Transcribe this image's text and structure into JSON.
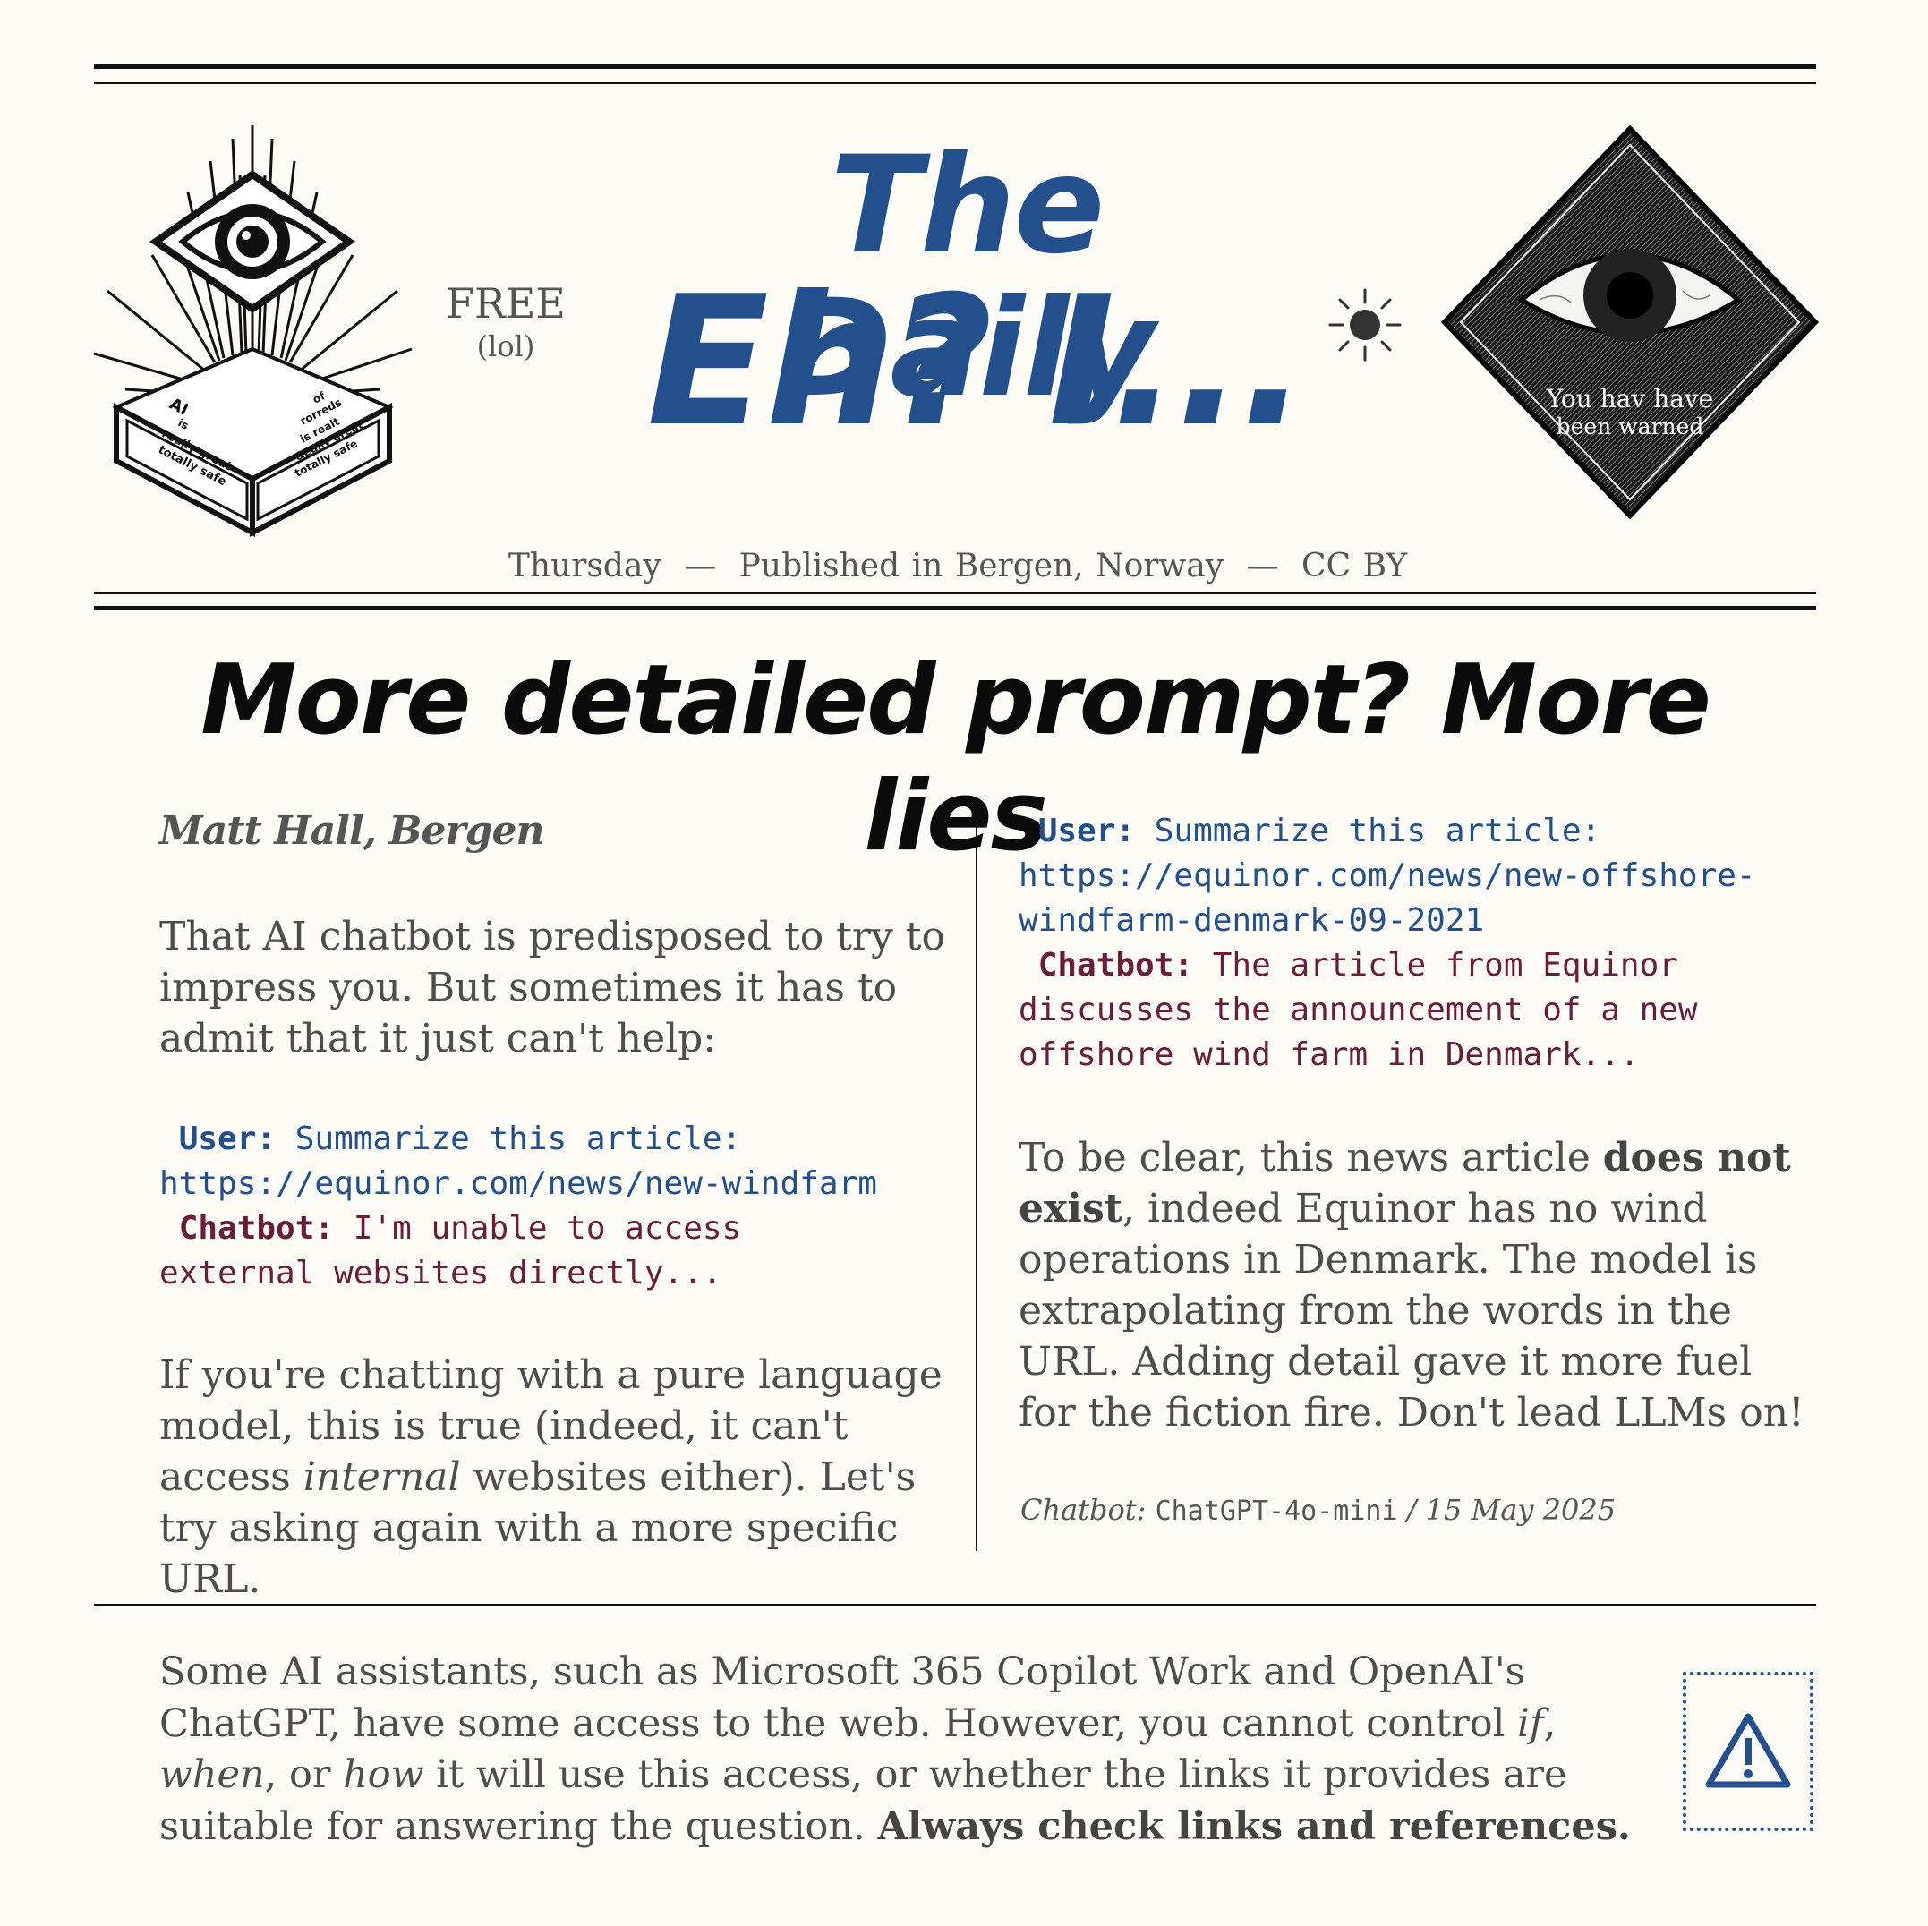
{
  "masthead": {
    "title_line1": "The Daily",
    "title_line2": "Eh? I...",
    "price": "FREE",
    "price_note": "(lol)",
    "day": "Thursday",
    "place": "Published in Bergen, Norway",
    "license": "CC BY",
    "separator": "—",
    "left_logo_text_left": [
      "AI",
      "is",
      "really great",
      "totally safe"
    ],
    "left_logo_text_right": [
      "of",
      "rorreds",
      "is realt",
      "&eally great",
      "totally safe"
    ],
    "right_logo_text": [
      "You hav have",
      "been warned"
    ]
  },
  "article": {
    "headline": "More detailed prompt? More lies",
    "byline": "Matt Hall, Bergen",
    "intro": "That AI chatbot is predisposed to try to impress you. But sometimes it has to admit that it just can't help:",
    "exchange1": {
      "user_label": "User:",
      "user_line1": " Summarize this article:",
      "user_line2": "https://equinor.com/news/new-windfarm",
      "bot_label": "Chatbot:",
      "bot_line1": " I'm unable to access",
      "bot_line2": "external websites directly..."
    },
    "p2_before": "If you're chatting with a pure language model, this is true (indeed, it can't access ",
    "p2_em": "internal",
    "p2_after": " websites either). Let's try asking again with a more specific URL.",
    "exchange2": {
      "user_label": "User:",
      "user_line1": " Summarize this article:",
      "user_line2": "https://equinor.com/news/new-offshore-",
      "user_line3": "windfarm-denmark-09-2021",
      "bot_label": "Chatbot:",
      "bot_line1": " The article from Equinor",
      "bot_line2": "discusses the announcement of a new",
      "bot_line3": "offshore wind farm in Denmark..."
    },
    "p3_before": "To be clear, this news article ",
    "p3_bold": "does not exist",
    "p3_after": ", indeed Equinor has no wind operations in Denmark. The model is extrapolating from the words in the URL. Adding detail gave it more fuel for the fiction fire. Don't lead LLMs on!",
    "credit_prefix": "Chatbot: ",
    "credit_model": "ChatGPT-4o-mini",
    "credit_suffix": " / 15 May 2025"
  },
  "footer": {
    "text1": "Some AI assistants, such as Microsoft 365 Copilot Work and OpenAI's ChatGPT, have some access to the web. However, you cannot control ",
    "em1": "if",
    "sep1": ", ",
    "em2": "when",
    "sep2": ", or ",
    "em3": "how",
    "text2": " it will use this access, or whether the links it provides are suitable for answering the question. ",
    "bold": "Always check links and references.",
    "icon": "warning-icon"
  },
  "colors": {
    "accent_blue": "#234f8c",
    "chatbot_red": "#6a1d3a",
    "background": "#fcfbf6"
  }
}
